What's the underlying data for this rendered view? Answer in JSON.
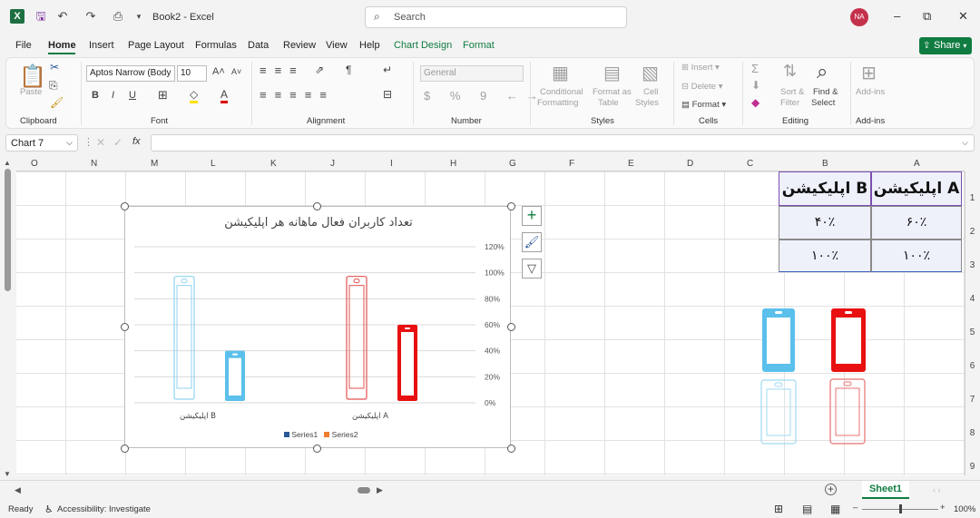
{
  "title_bar": {
    "doc_title": "Book2 - Excel",
    "search_placeholder": "Search",
    "user_initials": "NA",
    "app_logo_text": "X"
  },
  "menu": {
    "tabs": [
      "File",
      "Home",
      "Insert",
      "Page Layout",
      "Formulas",
      "Data",
      "Review",
      "View",
      "Help",
      "Chart Design",
      "Format"
    ],
    "active_tab": "Home",
    "share_label": "Share"
  },
  "ribbon": {
    "clipboard": {
      "paste": "Paste",
      "label": "Clipboard"
    },
    "font": {
      "name": "Aptos Narrow (Body",
      "size": "10",
      "label": "Font"
    },
    "alignment": {
      "label": "Alignment"
    },
    "number": {
      "format": "General",
      "label": "Number"
    },
    "styles": {
      "conditional": "Conditional",
      "formatting": "Formatting",
      "format_as": "Format as",
      "table": "Table",
      "cell": "Cell",
      "cell_styles": "Styles",
      "label": "Styles"
    },
    "cells": {
      "insert": "Insert",
      "delete": "Delete",
      "format": "Format",
      "label": "Cells"
    },
    "editing": {
      "sort": "Sort &",
      "filter": "Filter",
      "find": "Find &",
      "select": "Select",
      "label": "Editing"
    },
    "addins": {
      "addins": "Add-ins",
      "label": "Add-ins"
    }
  },
  "formula_bar": {
    "name_box": "Chart 7",
    "fx": "fx",
    "value": ""
  },
  "columns": [
    "O",
    "N",
    "M",
    "L",
    "K",
    "J",
    "I",
    "H",
    "G",
    "F",
    "E",
    "D",
    "C",
    "B",
    "A"
  ],
  "rows": [
    "1",
    "2",
    "3",
    "4",
    "5",
    "6",
    "7",
    "8",
    "9"
  ],
  "table": {
    "header_a": "اپلیکیشن A",
    "header_b": "اپلیکیشن B",
    "a2": "۶۰٪",
    "b2": "۴۰٪",
    "a3": "۱۰۰٪",
    "b3": "۱۰۰٪"
  },
  "chart_data": {
    "type": "bar",
    "title": "تعداد کاربران فعال ماهانه هر اپلیکیشن",
    "categories": [
      "اپلیکیشن A",
      "اپلیکیشن B"
    ],
    "series": [
      {
        "name": "Series1",
        "values": [
          60,
          40
        ],
        "color": "#e00000"
      },
      {
        "name": "Series2",
        "values": [
          100,
          100
        ],
        "color": "#f07c30"
      }
    ],
    "y_ticks": [
      "0%",
      "20%",
      "40%",
      "60%",
      "80%",
      "100%",
      "120%"
    ],
    "ylim": [
      0,
      120
    ],
    "legend_position": "bottom",
    "phone_colors": {
      "A": "#e81010",
      "B": "#5bc0eb"
    }
  },
  "sheet": {
    "tab": "Sheet1"
  },
  "status": {
    "ready": "Ready",
    "accessibility": "Accessibility: Investigate",
    "zoom": "100%"
  }
}
